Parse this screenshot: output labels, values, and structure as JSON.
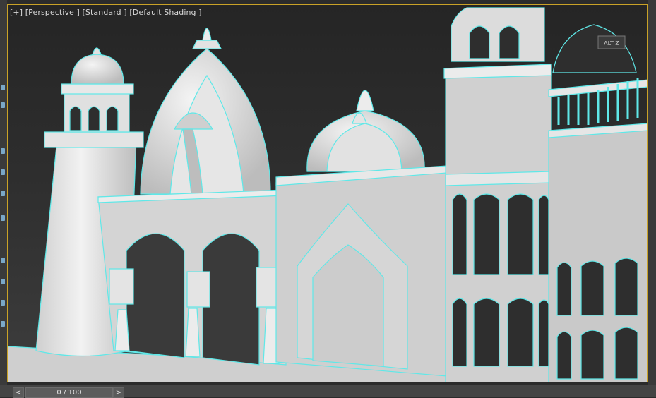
{
  "viewport": {
    "plus_label": "[+]",
    "view_label": "[Perspective ]",
    "style_label": "[Standard ]",
    "shading_label": "[Default Shading ]",
    "gizmo_text": "ALT Z"
  },
  "timeline": {
    "prev_label": "<",
    "frame_display": "0 / 100",
    "next_label": ">"
  },
  "colors": {
    "model_fill": "#d8d8d8",
    "wire_highlight": "#5fe8e8",
    "viewport_border": "#c9a227"
  }
}
